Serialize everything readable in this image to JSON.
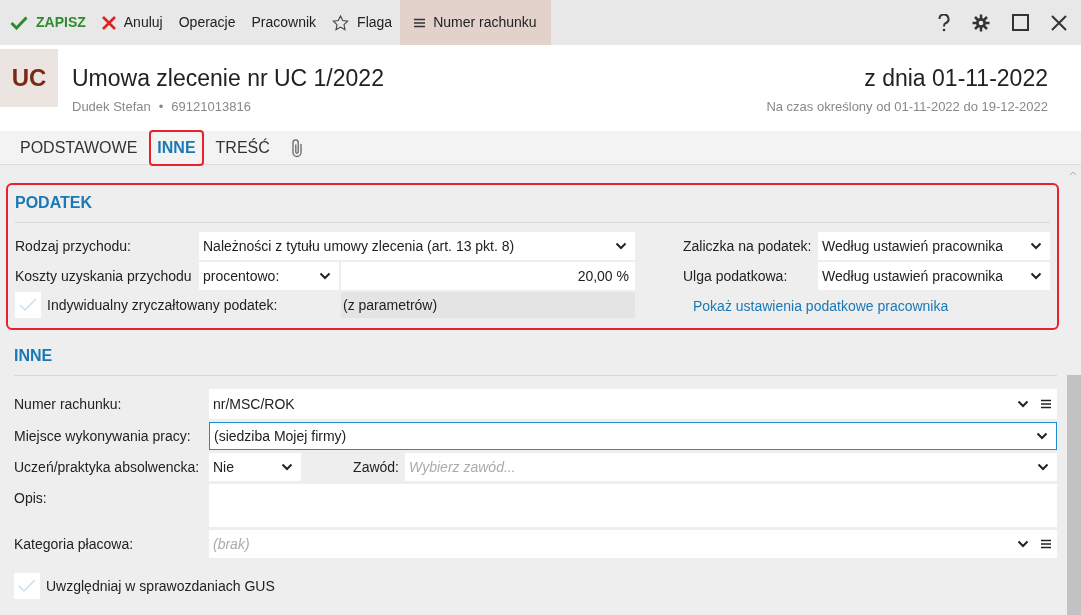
{
  "toolbar": [
    {
      "label": "ZAPISZ",
      "kind": "save",
      "selected": false
    },
    {
      "label": "Anuluj",
      "kind": "cancel",
      "selected": false
    },
    {
      "label": "Operacje",
      "kind": "plain",
      "selected": false
    },
    {
      "label": "Pracownik",
      "kind": "plain",
      "selected": false
    },
    {
      "label": "Flaga",
      "kind": "flag",
      "selected": false
    },
    {
      "label": "Numer rachunku",
      "kind": "panel",
      "selected": true
    }
  ],
  "header": {
    "badge": "UC",
    "title": "Umowa zlecenie nr UC 1/2022",
    "employee": "Dudek Stefan",
    "separator": "•",
    "pesel": "69121013816",
    "date": "z dnia 01-11-2022",
    "period": "Na czas określony od 01-11-2022 do 19-12-2022"
  },
  "tabs": [
    {
      "label": "PODSTAWOWE",
      "selected": false,
      "highlighted": false
    },
    {
      "label": "INNE",
      "selected": true,
      "highlighted": true
    },
    {
      "label": "TREŚĆ",
      "selected": false,
      "highlighted": false
    }
  ],
  "tax_section": {
    "title": "PODATEK",
    "highlighted": true,
    "income_type": {
      "label": "Rodzaj przychodu:",
      "value": "Należności z tytułu umowy zlecenia (art. 13 pkt. 8)"
    },
    "costs": {
      "label": "Koszty uzyskania przychodu",
      "mode": "procentowo:",
      "value": "20,00 %"
    },
    "flat_tax": {
      "label": "Indywidualny zryczałtowany podatek:",
      "checked": false,
      "value": "(z parametrów)"
    },
    "advance": {
      "label": "Zaliczka na podatek:",
      "value": "Według ustawień pracownika"
    },
    "relief": {
      "label": "Ulga podatkowa:",
      "value": "Według ustawień pracownika"
    },
    "link": "Pokaż ustawienia podatkowe pracownika"
  },
  "other_section": {
    "title": "INNE",
    "account": {
      "label": "Numer rachunku:",
      "value": "nr/MSC/ROK"
    },
    "workplace": {
      "label": "Miejsce wykonywania pracy:",
      "value": "(siedziba Mojej firmy)",
      "focused": true
    },
    "apprentice": {
      "label": "Uczeń/praktyka absolwencka:",
      "value": "Nie"
    },
    "profession": {
      "label": "Zawód:",
      "placeholder": "Wybierz zawód..."
    },
    "description": {
      "label": "Opis:"
    },
    "pay_category": {
      "label": "Kategoria płacowa:",
      "placeholder": "(brak)"
    },
    "gus": {
      "label": "Uwzględniaj w sprawozdaniach GUS",
      "checked": false
    }
  }
}
